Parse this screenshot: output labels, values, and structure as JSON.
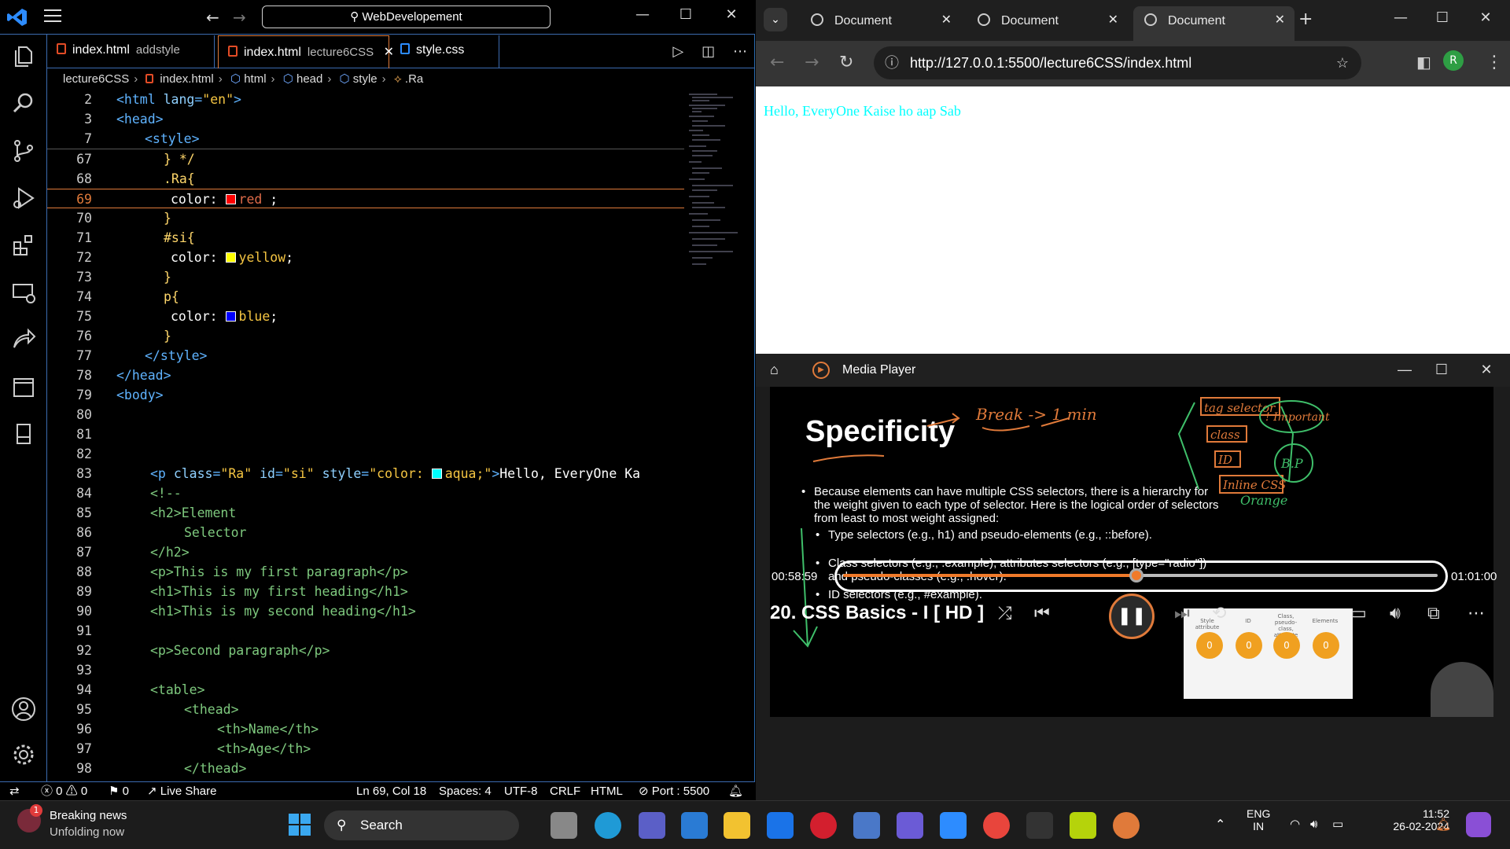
{
  "vscode": {
    "search": "WebDevelopement",
    "tabs": [
      {
        "name": "index.html",
        "sub": "addstyle"
      },
      {
        "name": "index.html",
        "sub": "lecture6CSS"
      },
      {
        "name": "style.css",
        "sub": ""
      }
    ],
    "breadcrumb": [
      "lecture6CSS",
      "index.html",
      "html",
      "head",
      "style",
      ".Ra"
    ],
    "sticky": [
      {
        "num": "2",
        "code": "<html lang=\"en\">"
      },
      {
        "num": "3",
        "code": "<head>"
      },
      {
        "num": "7",
        "code": "<style>"
      }
    ],
    "lines": [
      {
        "num": "67",
        "code": "} */"
      },
      {
        "num": "68",
        "code": ".Ra{"
      },
      {
        "num": "69",
        "code": "color: red ;"
      },
      {
        "num": "70",
        "code": "}"
      },
      {
        "num": "71",
        "code": "#si{"
      },
      {
        "num": "72",
        "code": "color: yellow;"
      },
      {
        "num": "73",
        "code": "}"
      },
      {
        "num": "74",
        "code": "p{"
      },
      {
        "num": "75",
        "code": "color: blue;"
      },
      {
        "num": "76",
        "code": "}"
      },
      {
        "num": "77",
        "code": "</style>"
      },
      {
        "num": "78",
        "code": "</head>"
      },
      {
        "num": "79",
        "code": "<body>"
      },
      {
        "num": "80",
        "code": ""
      },
      {
        "num": "81",
        "code": ""
      },
      {
        "num": "82",
        "code": ""
      },
      {
        "num": "83",
        "code": "<p class=\"Ra\" id=\"si\" style=\"color: aqua;\">Hello, EveryOne Ka"
      },
      {
        "num": "84",
        "code": "<!--"
      },
      {
        "num": "85",
        "code": "<h2>Element"
      },
      {
        "num": "86",
        "code": "Selector"
      },
      {
        "num": "87",
        "code": "</h2>"
      },
      {
        "num": "88",
        "code": "<p>This is my first paragraph</p>"
      },
      {
        "num": "89",
        "code": "<h1>This is my first heading</h1>"
      },
      {
        "num": "90",
        "code": "<h1>This is my second heading</h1>"
      },
      {
        "num": "91",
        "code": ""
      },
      {
        "num": "92",
        "code": "<p>Second paragraph</p>"
      },
      {
        "num": "93",
        "code": ""
      },
      {
        "num": "94",
        "code": "<table>"
      },
      {
        "num": "95",
        "code": "<thead>"
      },
      {
        "num": "96",
        "code": "<th>Name</th>"
      },
      {
        "num": "97",
        "code": "<th>Age</th>"
      },
      {
        "num": "98",
        "code": "</thead>"
      }
    ],
    "status": {
      "errors": "0",
      "warnings": "0",
      "ports": "0",
      "live_share": "Live Share",
      "position": "Ln 69, Col 18",
      "spaces": "Spaces: 4",
      "encoding": "UTF-8",
      "eol": "CRLF",
      "language": "HTML",
      "port": "Port : 5500"
    }
  },
  "browser": {
    "tabs": [
      "Document",
      "Document",
      "Document"
    ],
    "url": "http://127.0.0.1:5500/lecture6CSS/index.html",
    "profile_initial": "R",
    "page_text": "Hello, EveryOne Kaise ho aap Sab"
  },
  "media": {
    "app_title": "Media Player",
    "slide_title": "Specificity",
    "bullet_main": "Because elements can have multiple CSS selectors, there is a hierarchy for the weight given to each type of selector. Here is the logical order of selectors from least to most weight assigned:",
    "bullets": [
      "Type selectors (e.g., h1) and pseudo-elements (e.g., ::before).",
      "Class selectors (e.g., .example), attributes selectors (e.g., [type=\"radio\"]) and pseudo-classes (e.g., :hover).",
      "ID selectors (e.g., #example)."
    ],
    "table_headers": [
      "Style attribute",
      "ID",
      "Class, pseudo-class, attribute",
      "Elements"
    ],
    "table_values": [
      "0",
      "0",
      "0",
      "0"
    ],
    "handwriting": [
      "Break -> 1 min",
      "tag selector",
      "class",
      "ID",
      "Inline CSS",
      "! Important",
      "B.P",
      "Orange"
    ],
    "time_current": "00:58:59",
    "time_total": "01:01:00",
    "progress": 0.494,
    "video_title": "20. CSS Basics - I [ HD ]"
  },
  "taskbar": {
    "news_title": "Breaking news",
    "news_sub": "Unfolding now",
    "news_badge": "1",
    "search": "Search",
    "lang": "ENG",
    "region": "IN",
    "time": "11:52",
    "date": "26-02-2024"
  }
}
